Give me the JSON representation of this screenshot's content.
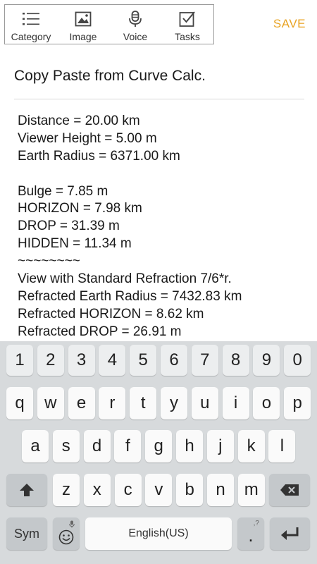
{
  "toolbar": {
    "items": [
      {
        "label": "Category",
        "icon": "list-icon"
      },
      {
        "label": "Image",
        "icon": "image-icon"
      },
      {
        "label": "Voice",
        "icon": "microphone-icon"
      },
      {
        "label": "Tasks",
        "icon": "checkbox-icon"
      }
    ],
    "save_label": "SAVE"
  },
  "note": {
    "title": "Copy Paste from Curve Calc.",
    "lines": [
      "Distance = 20.00 km",
      "Viewer Height = 5.00 m",
      "Earth Radius = 6371.00 km",
      "",
      "Bulge = 7.85 m",
      "HORIZON = 7.98 km",
      "DROP = 31.39 m",
      "HIDDEN = 11.34 m",
      "~~~~~~~~",
      "View with Standard Refraction 7/6*r.",
      "Refracted Earth Radius = 7432.83 km",
      "Refracted HORIZON = 8.62 km",
      "Refracted DROP = 26.91 m"
    ]
  },
  "keyboard": {
    "numbers": [
      "1",
      "2",
      "3",
      "4",
      "5",
      "6",
      "7",
      "8",
      "9",
      "0"
    ],
    "row1": [
      "q",
      "w",
      "e",
      "r",
      "t",
      "y",
      "u",
      "i",
      "o",
      "p"
    ],
    "row2": [
      "a",
      "s",
      "d",
      "f",
      "g",
      "h",
      "j",
      "k",
      "l"
    ],
    "row3": [
      "z",
      "x",
      "c",
      "v",
      "b",
      "n",
      "m"
    ],
    "sym_label": "Sym",
    "space_label": "English(US)",
    "period_label": ".",
    "period_hint": ",?"
  },
  "colors": {
    "accent": "#e8a323",
    "keyboard_bg": "#d7dadc",
    "key_bg": "#fafafa",
    "fn_key_bg": "#c4c8cb"
  }
}
